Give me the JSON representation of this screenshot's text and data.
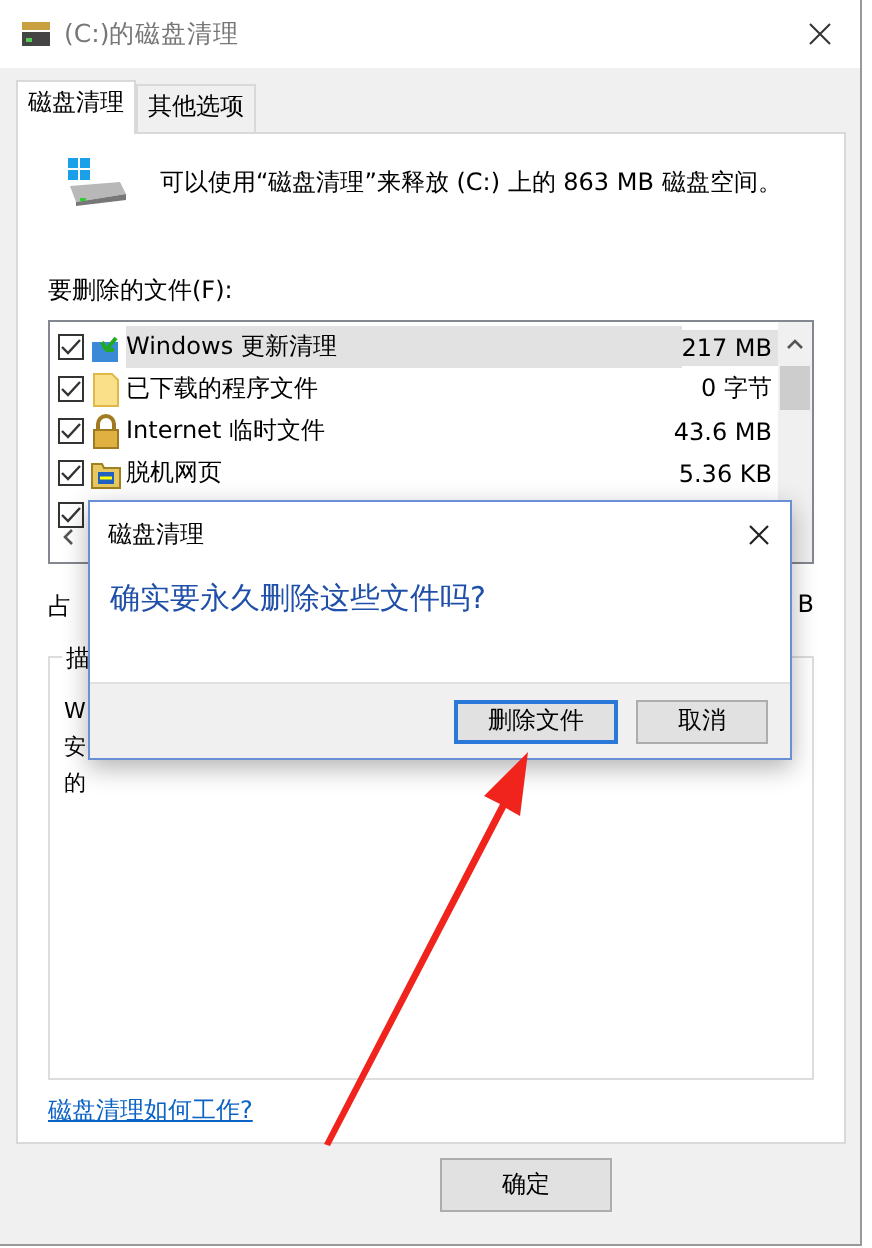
{
  "window": {
    "title": "(C:)的磁盘清理"
  },
  "tabs": [
    {
      "label": "磁盘清理",
      "selected": true
    },
    {
      "label": "其他选项",
      "selected": false
    }
  ],
  "summary": "可以使用“磁盘清理”来释放  (C:) 上的 863 MB 磁盘空间。",
  "files_label": "要删除的文件(F):",
  "files": [
    {
      "checked": true,
      "kind": "update",
      "name": "Windows 更新清理",
      "size": "217 MB",
      "selected": true
    },
    {
      "checked": true,
      "kind": "folder",
      "name": "已下载的程序文件",
      "size": "0 字节",
      "selected": false
    },
    {
      "checked": true,
      "kind": "lock",
      "name": "Internet 临时文件",
      "size": "43.6 MB",
      "selected": false
    },
    {
      "checked": true,
      "kind": "offline",
      "name": "脱机网页",
      "size": "5.36 KB",
      "selected": false
    },
    {
      "checked": true
    }
  ],
  "space_label": "占",
  "space_value": "B",
  "description": {
    "label": "描",
    "lines": [
      "W",
      "安",
      "的"
    ]
  },
  "help_link": "磁盘清理如何工作?",
  "buttons": [
    "确定"
  ],
  "confirm": {
    "title": "磁盘清理",
    "message": "确实要永久删除这些文件吗?",
    "buttons": [
      {
        "label": "删除文件",
        "focused": true
      },
      {
        "label": "取消",
        "focused": false
      }
    ]
  }
}
